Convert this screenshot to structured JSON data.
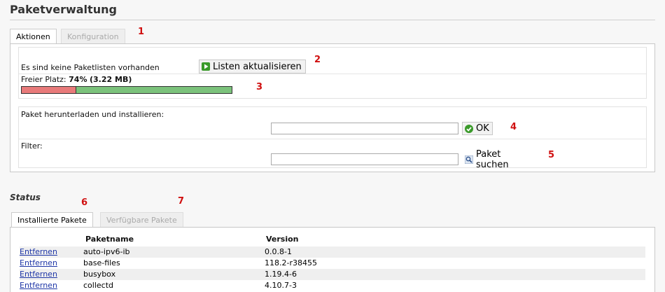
{
  "page": {
    "title": "Paketverwaltung"
  },
  "tabs": [
    {
      "label": "Aktionen",
      "active": true
    },
    {
      "label": "Konfiguration",
      "active": false
    }
  ],
  "actions": {
    "no_lists_text": "Es sind keine Paketlisten vorhanden",
    "update_lists_label": "Listen aktualisieren",
    "free_space_label": "Freier Platz:",
    "free_space_value": "74%",
    "free_space_detail": "(3.22 MB)",
    "free_space_fraction": 0.74,
    "bar_used_color": "#e87a7a",
    "bar_free_color": "#7bc27b",
    "download_label": "Paket herunterladen und installieren:",
    "download_value": "",
    "ok_label": "OK",
    "filter_label": "Filter:",
    "filter_value": "",
    "search_label": "Paket suchen"
  },
  "markers": [
    "1",
    "2",
    "3",
    "4",
    "5",
    "6",
    "7"
  ],
  "status": {
    "heading": "Status",
    "tabs": [
      {
        "label": "Installierte Pakete",
        "active": true
      },
      {
        "label": "Verfügbare Pakete",
        "active": false
      }
    ],
    "columns": [
      "Paketname",
      "Version"
    ],
    "rows": [
      {
        "action": "Entfernen",
        "name": "auto-ipv6-ib",
        "version": "0.0.8-1"
      },
      {
        "action": "Entfernen",
        "name": "base-files",
        "version": "118.2-r38455"
      },
      {
        "action": "Entfernen",
        "name": "busybox",
        "version": "1.19.4-6"
      },
      {
        "action": "Entfernen",
        "name": "collectd",
        "version": "4.10.7-3"
      }
    ]
  },
  "icons": {
    "refresh": "play-arrow-icon",
    "ok": "check-circle-icon",
    "search": "magnifier-icon"
  },
  "colors": {
    "marker": "#d01010",
    "link": "#1d35a6"
  }
}
